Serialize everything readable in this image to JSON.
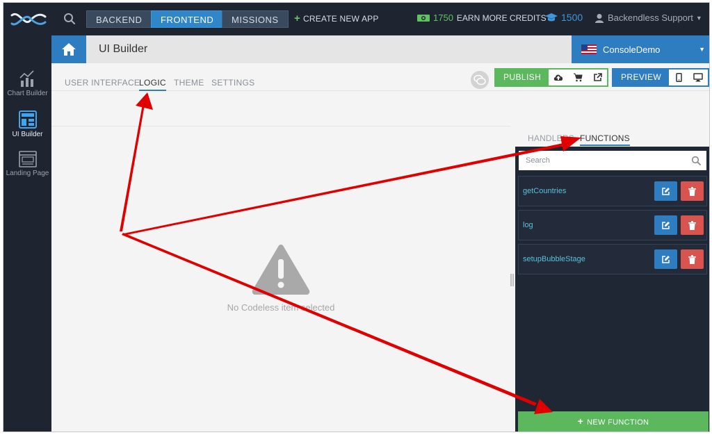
{
  "topbar": {
    "nav": [
      "BACKEND",
      "FRONTEND",
      "MISSIONS"
    ],
    "active_nav": "FRONTEND",
    "create_app": "CREATE NEW APP",
    "credits_value": "1750",
    "credits_label": "EARN MORE CREDITS",
    "edu_value": "1500",
    "user_name": "Backendless Support"
  },
  "leftrail": {
    "items": [
      {
        "label": "Chart Builder",
        "icon": "chart-icon"
      },
      {
        "label": "UI Builder",
        "icon": "layout-icon",
        "active": true
      },
      {
        "label": "Landing Page",
        "icon": "landing-page-icon"
      }
    ]
  },
  "header": {
    "title": "UI Builder",
    "app_name": "ConsoleDemo"
  },
  "subtabs": {
    "items": [
      "USER INTERFACE",
      "LOGIC",
      "THEME",
      "SETTINGS"
    ],
    "active": "LOGIC"
  },
  "actions": {
    "publish": "PUBLISH",
    "preview": "PREVIEW"
  },
  "canvas": {
    "empty_message": "No Codeless item selected"
  },
  "right_panel": {
    "tabs": [
      "HANDLERS",
      "FUNCTIONS"
    ],
    "active_tab": "FUNCTIONS",
    "search_placeholder": "Search",
    "functions": [
      "getCountries",
      "log",
      "setupBubbleStage"
    ],
    "new_function": "NEW FUNCTION"
  },
  "colors": {
    "accent_blue": "#2f7dc1",
    "success_green": "#5cb85c",
    "danger_red": "#d9534f",
    "dark_bg": "#1e2530",
    "annotation_red": "#e00000"
  }
}
